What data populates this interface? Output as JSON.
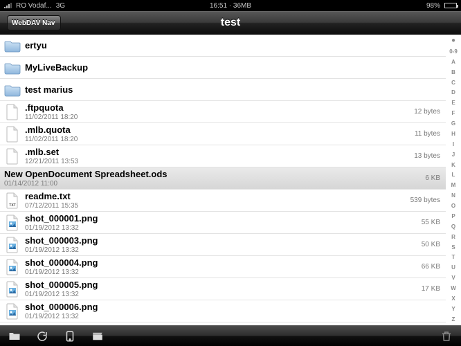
{
  "statusbar": {
    "carrier": "RO Vodaf...",
    "network": "3G",
    "time_mem": "16:51 · 36MB",
    "battery_percent": "98%"
  },
  "nav": {
    "back_label": "WebDAV Nav",
    "title": "test"
  },
  "files": [
    {
      "type": "folder",
      "name": "ertyu",
      "date": "",
      "size": ""
    },
    {
      "type": "folder",
      "name": "MyLiveBackup",
      "date": "",
      "size": ""
    },
    {
      "type": "folder",
      "name": "test marius",
      "date": "",
      "size": ""
    },
    {
      "type": "file",
      "name": ".ftpquota",
      "date": "11/02/2011 18:20",
      "size": "12 bytes"
    },
    {
      "type": "file",
      "name": ".mlb.quota",
      "date": "11/02/2011 18:20",
      "size": "11 bytes"
    },
    {
      "type": "file",
      "name": ".mlb.set",
      "date": "12/21/2011 13:53",
      "size": "13 bytes"
    },
    {
      "type": "file",
      "name": "New OpenDocument Spreadsheet.ods",
      "date": "01/14/2012 11:00",
      "size": "6 KB",
      "selected": true,
      "noicon": true
    },
    {
      "type": "txt",
      "name": "readme.txt",
      "date": "07/12/2011 15:35",
      "size": "539 bytes"
    },
    {
      "type": "img",
      "name": "shot_000001.png",
      "date": "01/19/2012 13:32",
      "size": "55 KB"
    },
    {
      "type": "img",
      "name": "shot_000003.png",
      "date": "01/19/2012 13:32",
      "size": "50 KB"
    },
    {
      "type": "img",
      "name": "shot_000004.png",
      "date": "01/19/2012 13:32",
      "size": "66 KB"
    },
    {
      "type": "img",
      "name": "shot_000005.png",
      "date": "01/19/2012 13:32",
      "size": "17 KB"
    },
    {
      "type": "img",
      "name": "shot_000006.png",
      "date": "01/19/2012 13:32",
      "size": ""
    }
  ],
  "index": [
    "●",
    "0-9",
    "A",
    "B",
    "C",
    "D",
    "E",
    "F",
    "G",
    "H",
    "I",
    "J",
    "K",
    "L",
    "M",
    "N",
    "O",
    "P",
    "Q",
    "R",
    "S",
    "T",
    "U",
    "V",
    "W",
    "X",
    "Y",
    "Z"
  ]
}
